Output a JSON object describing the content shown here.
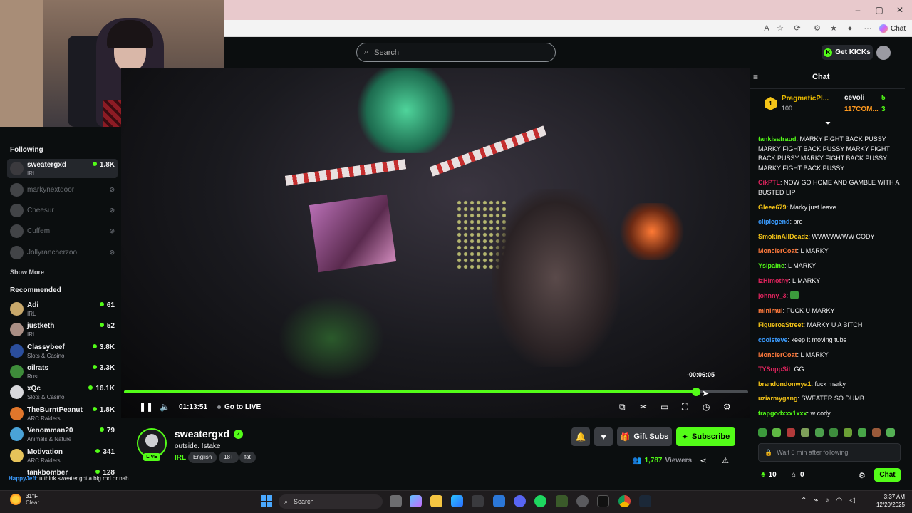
{
  "browser": {
    "chat_extension_label": "Chat"
  },
  "header": {
    "search_placeholder": "Search",
    "get_kicks_label": "Get KICKs"
  },
  "sidebar": {
    "following_title": "Following",
    "following": [
      {
        "name": "sweatergxd",
        "category": "IRL",
        "viewers": "1.8K",
        "online": true
      },
      {
        "name": "markynextdoor",
        "category": "",
        "viewers": "",
        "online": false
      },
      {
        "name": "Cheesur",
        "category": "",
        "viewers": "",
        "online": false
      },
      {
        "name": "Cuffem",
        "category": "",
        "viewers": "",
        "online": false
      },
      {
        "name": "Jollyrancherzoo",
        "category": "",
        "viewers": "",
        "online": false
      }
    ],
    "show_more_label": "Show More",
    "recommended_title": "Recommended",
    "recommended": [
      {
        "name": "Adi",
        "category": "IRL",
        "viewers": "61"
      },
      {
        "name": "justketh",
        "category": "IRL",
        "viewers": "52"
      },
      {
        "name": "Classybeef",
        "category": "Slots & Casino",
        "viewers": "3.8K"
      },
      {
        "name": "oilrats",
        "category": "Rust",
        "viewers": "3.3K"
      },
      {
        "name": "xQc",
        "category": "Slots & Casino",
        "viewers": "16.1K"
      },
      {
        "name": "TheBurntPeanut",
        "category": "ARC Raiders",
        "viewers": "1.8K"
      },
      {
        "name": "Venomman20",
        "category": "Animals & Nature",
        "viewers": "79"
      },
      {
        "name": "Motivation",
        "category": "ARC Raiders",
        "viewers": "341"
      },
      {
        "name": "tankbomber",
        "category": "",
        "viewers": "128"
      }
    ]
  },
  "player": {
    "time_remaining": "-00:06:05",
    "elapsed": "01:13:51",
    "go_live_label": "Go to LIVE",
    "progress_fraction": 0.917
  },
  "stream": {
    "streamer_name": "sweatergxd",
    "live_label": "LIVE",
    "title": "outside. !stake",
    "category": "IRL",
    "tags": [
      "English",
      "18+",
      "fat"
    ],
    "gift_subs_label": "Gift Subs",
    "subscribe_label": "Subscribe",
    "viewer_count": "1,787",
    "viewers_label": "Viewers"
  },
  "chat": {
    "title": "Chat",
    "leaderboard": {
      "rank": "1",
      "top_name": "PragmaticPl...",
      "top_amount": "100",
      "right": [
        {
          "name": "cevoli",
          "count": "5",
          "color": "#ffffff"
        },
        {
          "name": "117COM...",
          "count": "3",
          "color": "#ff9a1f"
        }
      ]
    },
    "messages": [
      {
        "user": "tankisafraud",
        "color": "#53fc18",
        "text": "MARKY FIGHT BACK PUSSY MARKY FIGHT BACK PUSSY MARKY FIGHT BACK PUSSY MARKY FIGHT BACK PUSSY MARKY FIGHT BACK PUSSY"
      },
      {
        "user": "CikPTL",
        "color": "#e0245e",
        "text": "NOW GO HOME AND GAMBLE WITH A BUSTED LIP"
      },
      {
        "user": "Gleee679",
        "color": "#f5c518",
        "text": "Marky just leave ."
      },
      {
        "user": "cliplegend",
        "color": "#3b9cff",
        "text": "bro"
      },
      {
        "user": "SmokinAllDeadz",
        "color": "#f5c518",
        "text": "WWWWWWW CODY"
      },
      {
        "user": "MonclerCoat",
        "color": "#ff7a3d",
        "text": "L MARKY"
      },
      {
        "user": "Ysipaine",
        "color": "#53fc18",
        "text": "L MARKY"
      },
      {
        "user": "IzHimothy",
        "color": "#e0245e",
        "text": "L MARKY"
      },
      {
        "user": "johnny_3",
        "color": "#e0245e",
        "text": ""
      },
      {
        "user": "minimul",
        "color": "#ff7a3d",
        "text": "FUCK U MARKY"
      },
      {
        "user": "FigueroaStreet",
        "color": "#f5c518",
        "text": "MARKY U A BITCH"
      },
      {
        "user": "coolsteve",
        "color": "#3b9cff",
        "text": "keep it moving tubs"
      },
      {
        "user": "MonclerCoat",
        "color": "#ff7a3d",
        "text": "L MARKY"
      },
      {
        "user": "TYSoppSit",
        "color": "#e0245e",
        "text": "GG"
      },
      {
        "user": "brandondonwya1",
        "color": "#f5c518",
        "text": "fuck marky"
      },
      {
        "user": "uziarmygang",
        "color": "#f5c518",
        "text": "SWEATER SO DUMB"
      },
      {
        "user": "trapgodxxx1xxx",
        "color": "#53fc18",
        "text": "w cody"
      }
    ],
    "input_placeholder": "Wait 6 min after following",
    "points": "10",
    "store_count": "0",
    "send_label": "Chat"
  },
  "overlay": {
    "user": "HappyJeff",
    "text": "u think sweater got a big rod or nah"
  },
  "taskbar": {
    "temperature": "31°F",
    "condition": "Clear",
    "search_label": "Search",
    "time": "3:37 AM",
    "date": "12/20/2025"
  }
}
